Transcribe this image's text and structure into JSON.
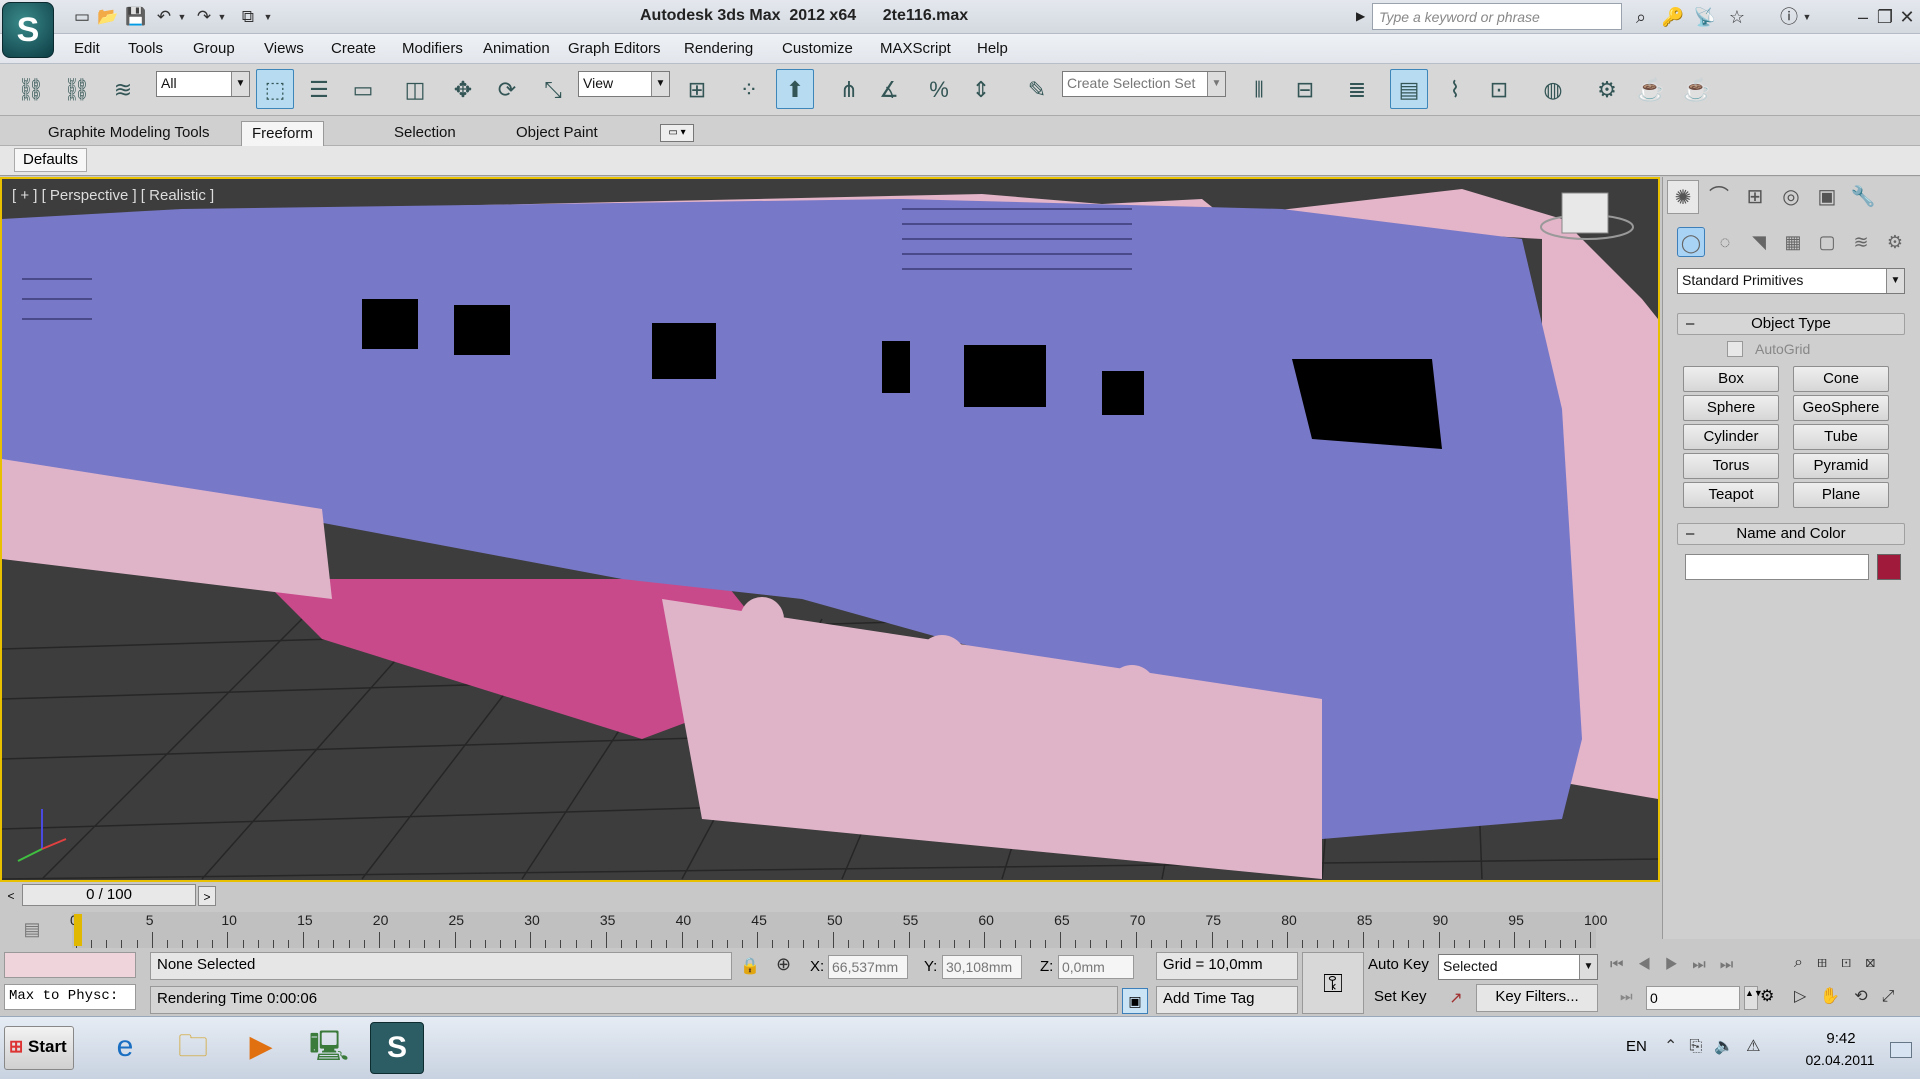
{
  "app": {
    "title": "Autodesk 3ds Max  2012 x64",
    "file": "2te116.max",
    "logo_glyph": "S",
    "search_placeholder": "Type a keyword or phrase"
  },
  "menu": [
    "Edit",
    "Tools",
    "Group",
    "Views",
    "Create",
    "Modifiers",
    "Animation",
    "Graph Editors",
    "Rendering",
    "Customize",
    "MAXScript",
    "Help"
  ],
  "toolbar": {
    "filter_value": "All",
    "ref_coord_value": "View",
    "named_selection_placeholder": "Create Selection Set"
  },
  "ribbon": {
    "tabs": [
      "Graphite Modeling Tools",
      "Freeform",
      "Selection",
      "Object Paint"
    ],
    "active_tab": "Freeform",
    "panel_label": "Defaults"
  },
  "viewport": {
    "label": "[ + ] [ Perspective ] [ Realistic ]"
  },
  "command_panel": {
    "category_value": "Standard Primitives",
    "object_type_header": "Object Type",
    "autogrid_label": "AutoGrid",
    "buttons": [
      "Box",
      "Cone",
      "Sphere",
      "GeoSphere",
      "Cylinder",
      "Tube",
      "Torus",
      "Pyramid",
      "Teapot",
      "Plane"
    ],
    "name_color_header": "Name and Color",
    "object_name": "",
    "color": "#a01a3c"
  },
  "timeline": {
    "slider_text": "0 / 100",
    "ticks": [
      "0",
      "5",
      "10",
      "15",
      "20",
      "25",
      "30",
      "35",
      "40",
      "45",
      "50",
      "55",
      "60",
      "65",
      "70",
      "75",
      "80",
      "85",
      "90",
      "95",
      "100"
    ]
  },
  "status": {
    "maxscript_text": "Max to Physc:",
    "selection_text": "None Selected",
    "prompt_text": "Rendering Time  0:00:06",
    "x_label": "X:",
    "x_value": "66,537mm",
    "y_label": "Y:",
    "y_value": "30,108mm",
    "z_label": "Z:",
    "z_value": "0,0mm",
    "grid_text": "Grid = 10,0mm",
    "add_time_tag": "Add Time Tag",
    "auto_key": "Auto Key",
    "set_key": "Set Key",
    "key_mode_value": "Selected",
    "key_filters": "Key Filters...",
    "frame_value": "0"
  },
  "taskbar": {
    "start_label": "Start",
    "lang": "EN",
    "time": "9:42",
    "date": "02.04.2011"
  },
  "colors": {
    "viewport_bg": "#3d3d3d",
    "loco_body": "#7878c8",
    "loco_skirt": "#c84a8a",
    "bogie": "#e0b4c8",
    "active_border": "#e8c000"
  }
}
